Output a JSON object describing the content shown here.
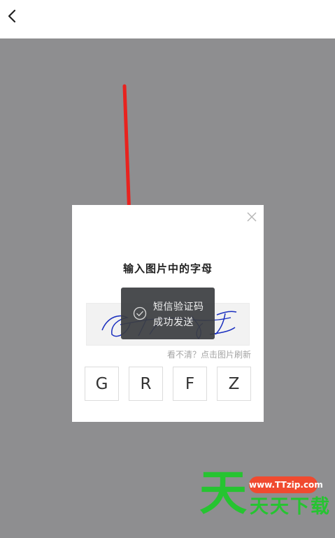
{
  "dialog": {
    "title": "输入图片中的字母",
    "refresh_hint": "看不清？点击图片刷新",
    "code_chars": [
      "G",
      "R",
      "F",
      "Z"
    ]
  },
  "toast": {
    "line1": "短信验证码",
    "line2": "成功发送"
  },
  "watermark": {
    "big_char": "天",
    "url": "www.TTzip.com",
    "text": "天天下载"
  },
  "colors": {
    "overlay": "#8e8e90",
    "arrow": "#e8231f",
    "captcha_ink": "#1a2fbf",
    "watermark_green": "#26c431",
    "watermark_red": "#f04a2f"
  }
}
